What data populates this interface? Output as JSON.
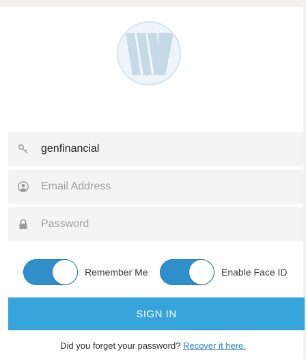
{
  "logo": {
    "name": "w-logo"
  },
  "fields": {
    "server": {
      "value": "genfinancial",
      "icon": "key-icon"
    },
    "email": {
      "placeholder": "Email Address",
      "icon": "user-circle-icon"
    },
    "password": {
      "placeholder": "Password",
      "icon": "lock-icon"
    }
  },
  "toggles": {
    "remember_me": {
      "label": "Remember Me",
      "on": true
    },
    "face_id": {
      "label": "Enable Face ID",
      "on": true
    }
  },
  "signin": {
    "label": "SIGN IN"
  },
  "forgot": {
    "text": "Did you forget your password?",
    "link": "Recover it here."
  },
  "colors": {
    "accent": "#37a3db",
    "toggle": "#2f8fcb",
    "field_bg": "#f4f4f4"
  }
}
